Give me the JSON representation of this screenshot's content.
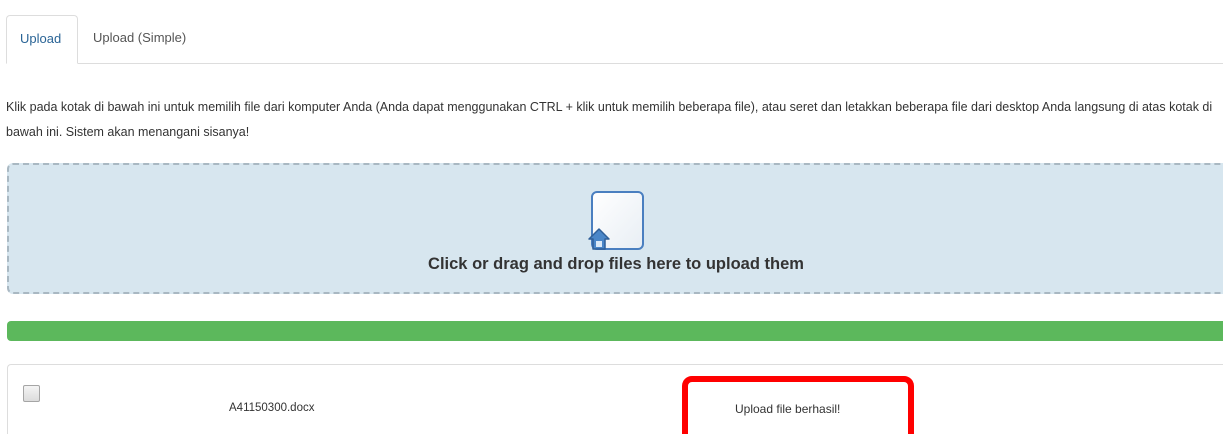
{
  "tabs": [
    {
      "label": "Upload",
      "active": true
    },
    {
      "label": "Upload (Simple)",
      "active": false
    }
  ],
  "instructions": "Klik pada kotak di bawah ini untuk memilih file dari komputer Anda (Anda dapat menggunakan CTRL + klik untuk memilih beberapa file), atau seret dan letakkan beberapa file dari desktop Anda langsung di atas kotak di bawah ini. Sistem akan menangani sisanya!",
  "dropzone": {
    "label": "Click or drag and drop files here to upload them",
    "icon": "file-upload-icon"
  },
  "progress": {
    "percent": 100,
    "color": "#5cb85c"
  },
  "files": [
    {
      "name": "A41150300.docx",
      "status": "Upload file berhasil!",
      "checked": false
    }
  ],
  "colors": {
    "active_tab_text": "#2a6496",
    "dropzone_bg": "#d7e6ef",
    "highlight": "#ff0000"
  }
}
